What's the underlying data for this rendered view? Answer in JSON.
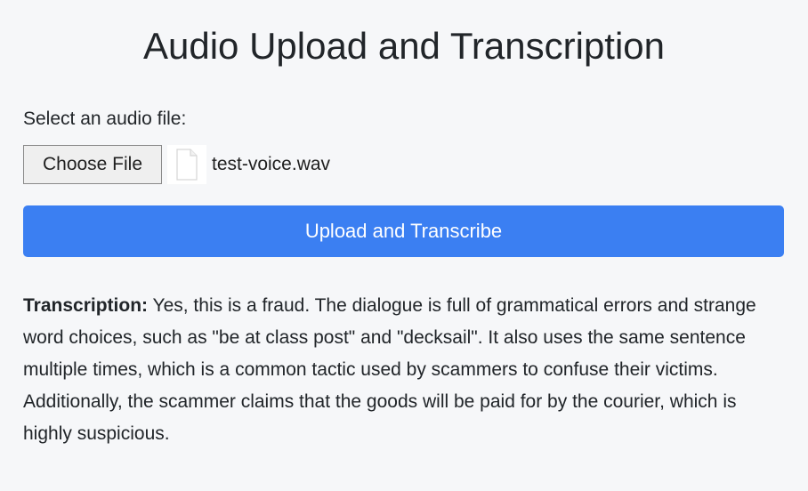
{
  "page": {
    "title": "Audio Upload and Transcription"
  },
  "upload_form": {
    "file_label": "Select an audio file:",
    "choose_file_label": "Choose File",
    "selected_file_name": "test-voice.wav",
    "file_icon": "document-icon",
    "submit_label": "Upload and Transcribe",
    "submit_color": "#3b7ff2"
  },
  "result": {
    "label": "Transcription:",
    "text": "Yes, this is a fraud. The dialogue is full of grammatical errors and strange word choices, such as \"be at class post\" and \"decksail\". It also uses the same sentence multiple times, which is a common tactic used by scammers to confuse their victims. Additionally, the scammer claims that the goods will be paid for by the courier, which is highly suspicious."
  }
}
